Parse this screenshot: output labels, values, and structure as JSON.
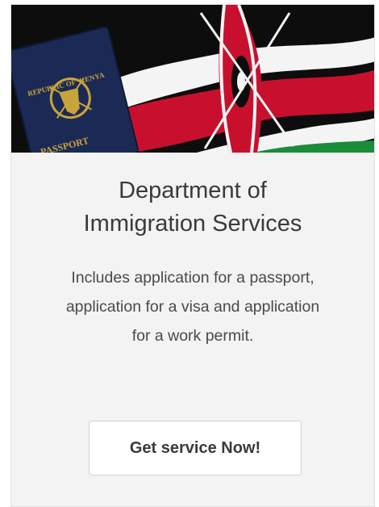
{
  "card": {
    "hero": {
      "alt": "Kenyan passport and flag",
      "passport_lines": [
        "REPUBLIC OF",
        "KENYA"
      ],
      "passport_word": "PASSPORT",
      "colors": {
        "passport": "#1b2a55",
        "gold": "#c9a43a",
        "flag_red": "#c8102e",
        "flag_green": "#1a8c3a",
        "flag_black": "#0d0d0d",
        "flag_white": "#f4f4f4"
      }
    },
    "title_lines": [
      "Department of",
      "Immigration Services"
    ],
    "description_lines": [
      "Includes application for a passport,",
      "application for a visa and application",
      "for a work permit."
    ],
    "button_label": "Get service Now!"
  }
}
